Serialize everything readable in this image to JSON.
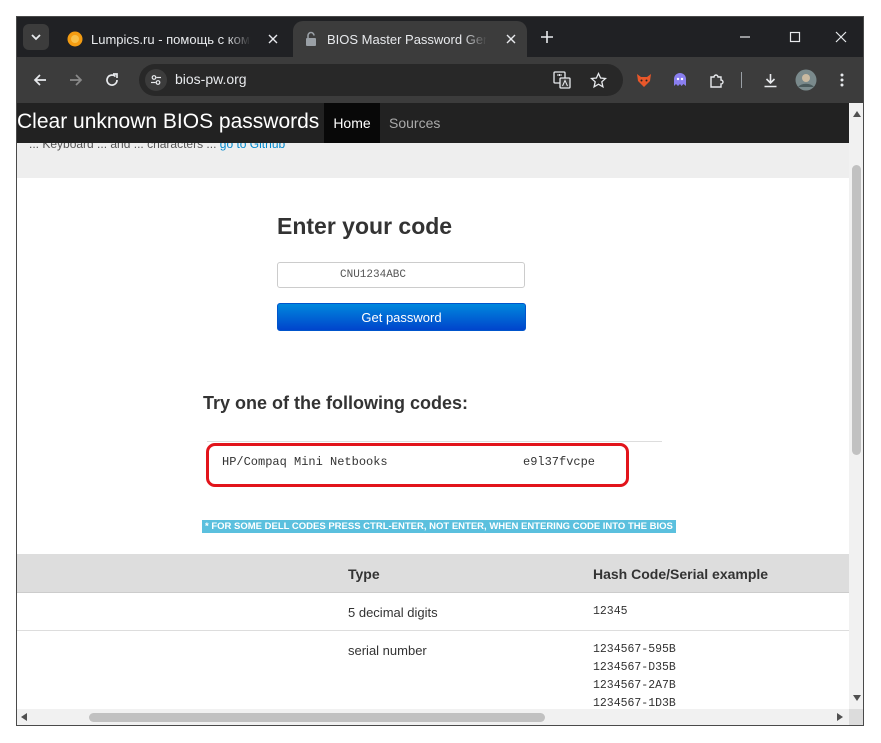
{
  "tabs": [
    {
      "title": "Lumpics.ru - помощь с компьютером"
    },
    {
      "title": "BIOS Master Password Generator"
    }
  ],
  "toolbar": {
    "url": "bios-pw.org"
  },
  "site": {
    "brand": "Clear unknown BIOS passwords",
    "nav": {
      "home": "Home",
      "sources": "Sources"
    },
    "truncated_text": "... Keyboard ... and ... characters ...",
    "truncated_link": "go to Github"
  },
  "form": {
    "title": "Enter your code",
    "placeholder": "CNU1234ABC",
    "button": "Get password"
  },
  "results": {
    "title": "Try one of the following codes:",
    "items": [
      {
        "model": "HP/Compaq Mini Netbooks",
        "code": "e9l37fvcpe"
      }
    ]
  },
  "note": "* FOR SOME DELL CODES PRESS CTRL-ENTER, NOT ENTER, WHEN ENTERING CODE INTO THE BIOS",
  "table": {
    "headers": {
      "type": "Type",
      "hash": "Hash Code/Serial example"
    },
    "rows": [
      {
        "type": "5 decimal digits",
        "examples": [
          "12345"
        ]
      },
      {
        "type": "serial number",
        "examples": [
          "1234567-595B",
          "1234567-D35B",
          "1234567-2A7B",
          "1234567-1D3B"
        ]
      }
    ]
  },
  "colors": {
    "highlight": "#e2141b",
    "note_bg": "#5bc0de",
    "button_blue": "#0066dd"
  }
}
